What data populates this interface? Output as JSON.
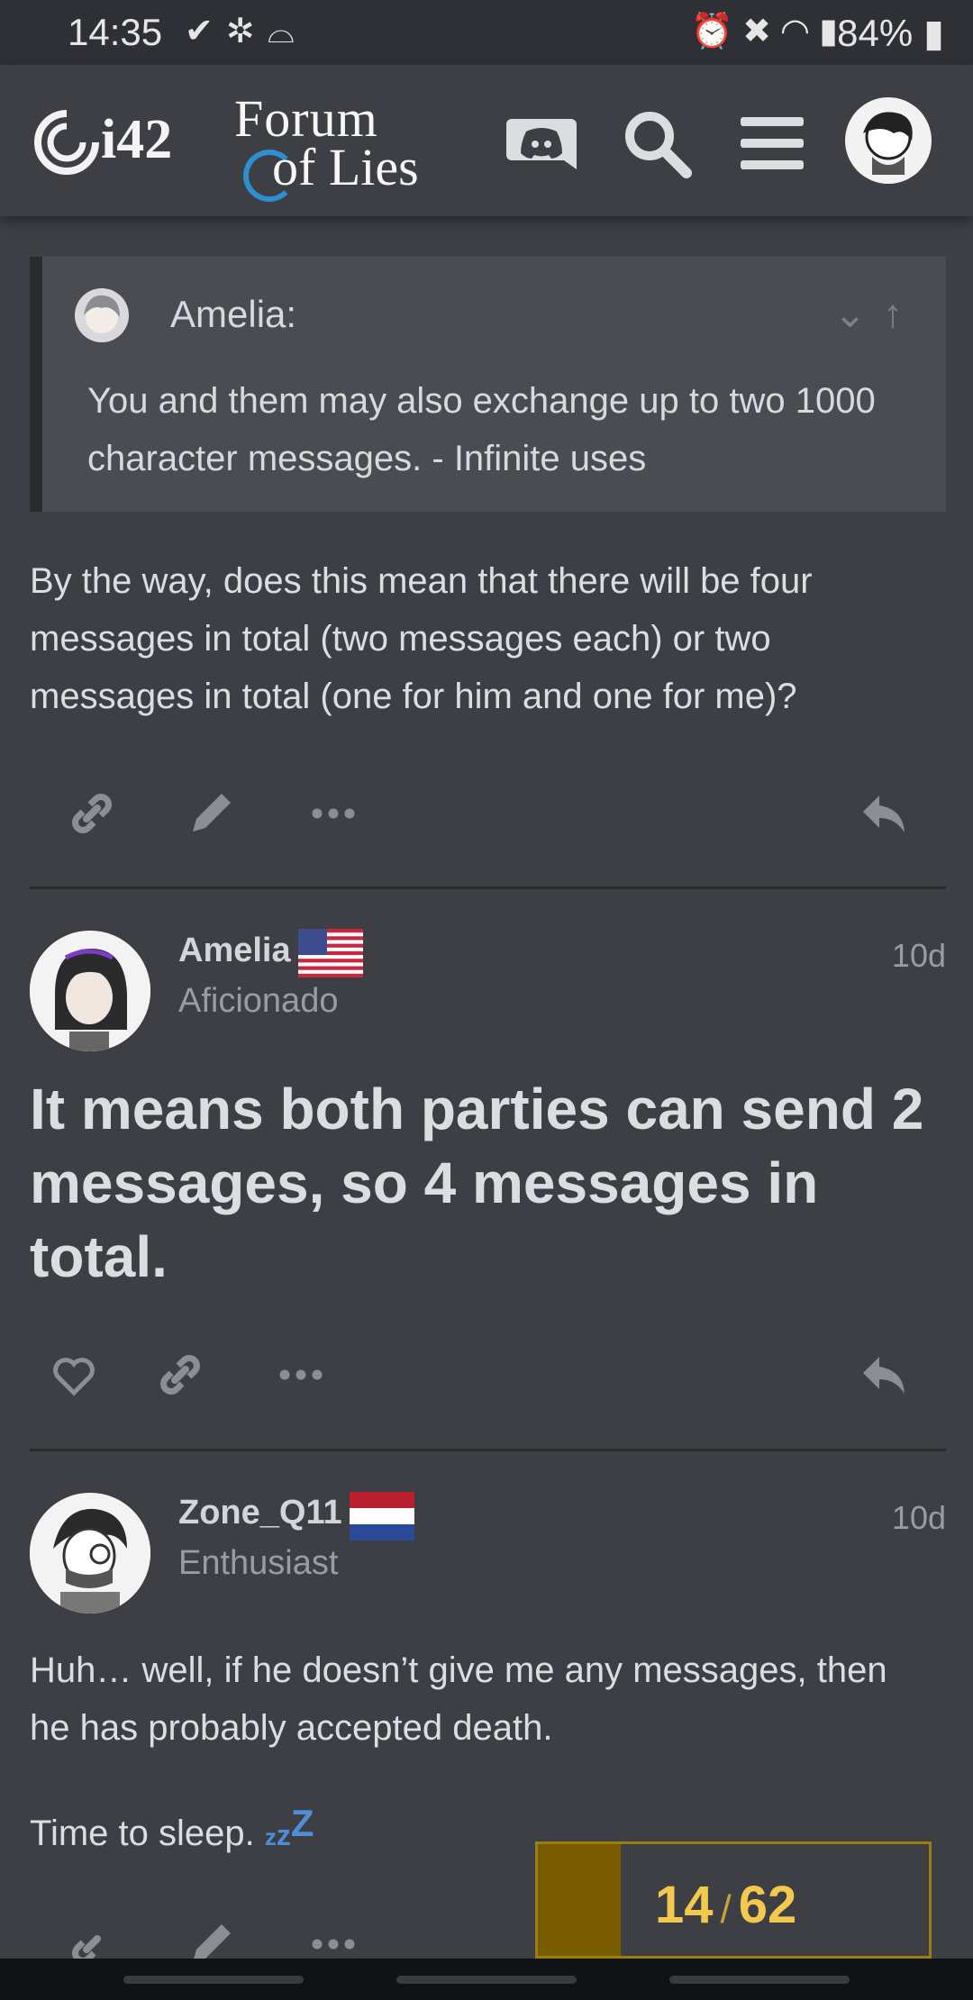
{
  "status_bar": {
    "time": "14:35",
    "left_icons": [
      "check-icon",
      "fan-icon",
      "incognito-icon"
    ],
    "right_icons": [
      "alarm-icon",
      "mute-icon",
      "wifi-icon",
      "signal-icon"
    ],
    "battery": "84%"
  },
  "header": {
    "logo_i42": "i42",
    "logo_line1": "Forum",
    "logo_line2": "of Lies",
    "icons": [
      "discord-icon",
      "search-icon",
      "menu-icon",
      "user-avatar"
    ]
  },
  "quote": {
    "author": "Amelia:",
    "text": "You and them may also exchange up to two 1000 character messages. - Infinite uses",
    "controls": [
      "chevron-down-icon",
      "arrow-up-icon"
    ]
  },
  "post1": {
    "text": "By the way, does this mean that there will be four messages in total (two messages each) or two messages in total (one for him and one for me)?",
    "actions": [
      "link-icon",
      "edit-icon",
      "more-icon",
      "reply-icon"
    ]
  },
  "post2": {
    "username": "Amelia",
    "flag": "us-flag",
    "title": "Aficionado",
    "date": "10d",
    "text": "It means both parties can send 2 messages, so 4 messages in total.",
    "actions": [
      "like-icon",
      "link-icon",
      "more-icon",
      "reply-icon"
    ]
  },
  "post3": {
    "username": "Zone_Q11",
    "flag": "nl-flag",
    "title": "Enthusiast",
    "date": "10d",
    "text1": "Huh… well, if he doesn’t give me any messages, then he has probably accepted death.",
    "text2": "Time to sleep.",
    "emoji": "zzz",
    "actions": [
      "link-icon",
      "edit-icon",
      "more-icon"
    ]
  },
  "progress": {
    "current": "14",
    "separator": "/",
    "total": "62",
    "fraction": 0.226
  },
  "colors": {
    "background": "#3d3f45",
    "accent_yellow": "#f2c94c",
    "discord": "#dcdde0"
  }
}
